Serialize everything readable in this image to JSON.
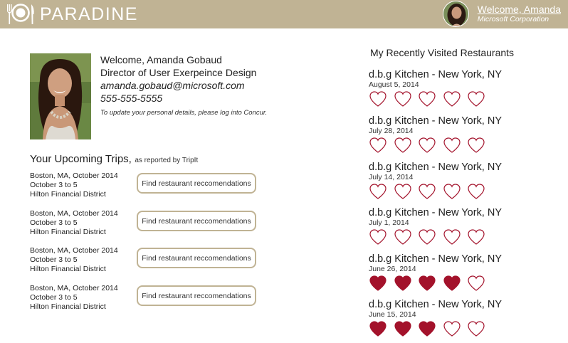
{
  "header": {
    "brand": "PARADINE",
    "welcome_link": "Welcome, Amanda",
    "company": "Microsoft Corporation"
  },
  "profile": {
    "greeting": "Welcome, Amanda Gobaud",
    "title": "Director of User Exerpeince Design",
    "email": "amanda.gobaud@microsoft.com",
    "phone": "555-555-5555",
    "note": "To update your personal details, please log into Concur."
  },
  "trips": {
    "heading": "Your Upcoming Trips,",
    "source": "as reported by TripIt",
    "items": [
      {
        "place": "Boston, MA, October 2014",
        "dates": "October 3 to 5",
        "hotel": "Hilton Financial District",
        "button": "Find restaurant reccomendations"
      },
      {
        "place": "Boston, MA, October 2014",
        "dates": "October 3 to 5",
        "hotel": "Hilton Financial District",
        "button": "Find restaurant reccomendations"
      },
      {
        "place": "Boston, MA, October 2014",
        "dates": "October 3 to 5",
        "hotel": "Hilton Financial District",
        "button": "Find restaurant reccomendations"
      },
      {
        "place": "Boston, MA, October 2014",
        "dates": "October 3 to 5",
        "hotel": "Hilton Financial District",
        "button": "Find restaurant reccomendations"
      }
    ]
  },
  "recent": {
    "heading": "My Recently Visited Restaurants",
    "items": [
      {
        "name": "d.b.g Kitchen - New York, NY",
        "date": "August 5, 2014",
        "rating": 0,
        "max": 5
      },
      {
        "name": "d.b.g Kitchen - New York, NY",
        "date": "July 28, 2014",
        "rating": 0,
        "max": 5
      },
      {
        "name": "d.b.g Kitchen - New York, NY",
        "date": "July 14, 2014",
        "rating": 0,
        "max": 5
      },
      {
        "name": "d.b.g Kitchen - New York, NY",
        "date": "July 1, 2014",
        "rating": 0,
        "max": 5
      },
      {
        "name": "d.b.g Kitchen - New York, NY",
        "date": "June 26, 2014",
        "rating": 4,
        "max": 5
      },
      {
        "name": "d.b.g Kitchen - New York, NY",
        "date": "June 15, 2014",
        "rating": 3,
        "max": 5
      }
    ]
  },
  "colors": {
    "header_bg": "#c0b394",
    "heart": "#a3122b",
    "button_border": "#c0b394"
  },
  "icons": {
    "logo": "plate-and-cutlery-icon",
    "rating": "heart-icon"
  }
}
